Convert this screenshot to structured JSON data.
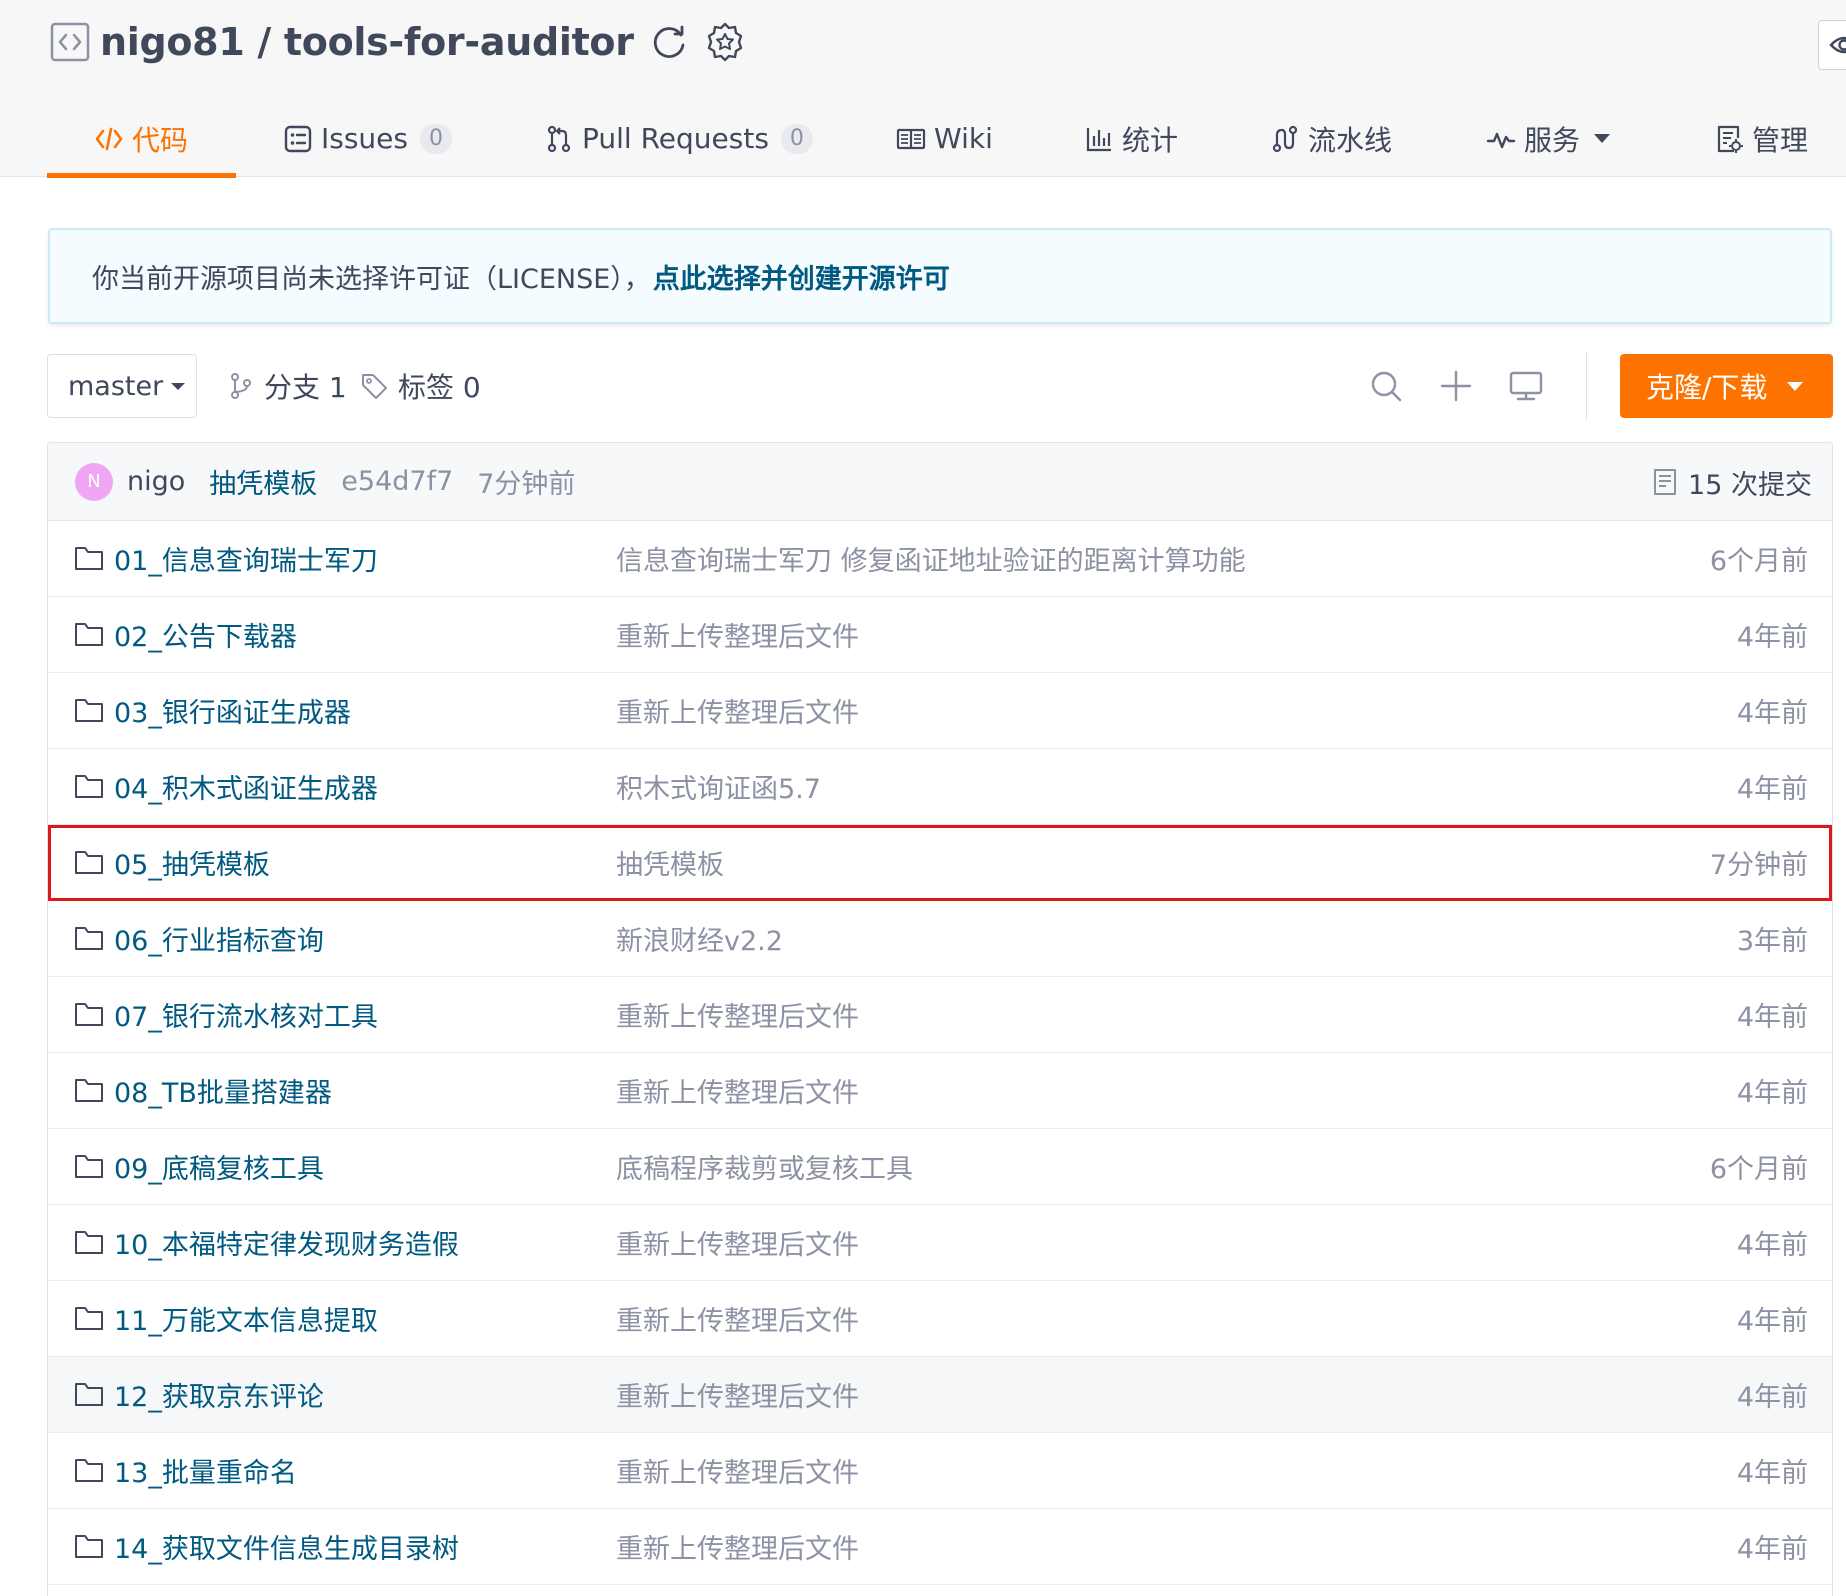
{
  "repo": {
    "owner": "nigo81",
    "name": "tools-for-auditor",
    "title": "nigo81 / tools-for-auditor"
  },
  "tabs": [
    {
      "label": "代码",
      "icon": "code-icon",
      "active": true
    },
    {
      "label": "Issues",
      "icon": "issues-icon",
      "count": "0"
    },
    {
      "label": "Pull Requests",
      "icon": "pull-request-icon",
      "count": "0"
    },
    {
      "label": "Wiki",
      "icon": "wiki-icon"
    },
    {
      "label": "统计",
      "icon": "stats-icon"
    },
    {
      "label": "流水线",
      "icon": "pipeline-icon"
    },
    {
      "label": "服务",
      "icon": "pulse-icon",
      "has_dropdown": true
    },
    {
      "label": "管理",
      "icon": "manage-icon"
    }
  ],
  "notice": {
    "text": "你当前开源项目尚未选择许可证（LICENSE），",
    "link": "点此选择并创建开源许可"
  },
  "toolbar": {
    "branch": "master",
    "branches": "分支 1",
    "tags": "标签 0",
    "clone_label": "克隆/下载"
  },
  "last_commit": {
    "avatar_letter": "N",
    "author": "nigo",
    "message": "抽凭模板",
    "sha": "e54d7f7",
    "time": "7分钟前",
    "count": "15 次提交"
  },
  "files": [
    {
      "name": "01_信息查询瑞士军刀",
      "message": "信息查询瑞士军刀 修复函证地址验证的距离计算功能",
      "time": "6个月前"
    },
    {
      "name": "02_公告下载器",
      "message": "重新上传整理后文件",
      "time": "4年前"
    },
    {
      "name": "03_银行函证生成器",
      "message": "重新上传整理后文件",
      "time": "4年前"
    },
    {
      "name": "04_积木式函证生成器",
      "message": "积木式询证函5.7",
      "time": "4年前"
    },
    {
      "name": "05_抽凭模板",
      "message": "抽凭模板",
      "time": "7分钟前",
      "highlighted": true
    },
    {
      "name": "06_行业指标查询",
      "message": "新浪财经v2.2",
      "time": "3年前"
    },
    {
      "name": "07_银行流水核对工具",
      "message": "重新上传整理后文件",
      "time": "4年前"
    },
    {
      "name": "08_TB批量搭建器",
      "message": "重新上传整理后文件",
      "time": "4年前"
    },
    {
      "name": "09_底稿复核工具",
      "message": "底稿程序裁剪或复核工具",
      "time": "6个月前"
    },
    {
      "name": "10_本福特定律发现财务造假",
      "message": "重新上传整理后文件",
      "time": "4年前"
    },
    {
      "name": "11_万能文本信息提取",
      "message": "重新上传整理后文件",
      "time": "4年前"
    },
    {
      "name": "12_获取京东评论",
      "message": "重新上传整理后文件",
      "time": "4年前",
      "hovered": true
    },
    {
      "name": "13_批量重命名",
      "message": "重新上传整理后文件",
      "time": "4年前"
    },
    {
      "name": "14_获取文件信息生成目录树",
      "message": "重新上传整理后文件",
      "time": "4年前"
    }
  ],
  "colors": {
    "accent": "#fe7300",
    "link": "#005980",
    "muted": "#8c92a4",
    "text": "#40485b",
    "highlight_border": "#e0161d"
  }
}
